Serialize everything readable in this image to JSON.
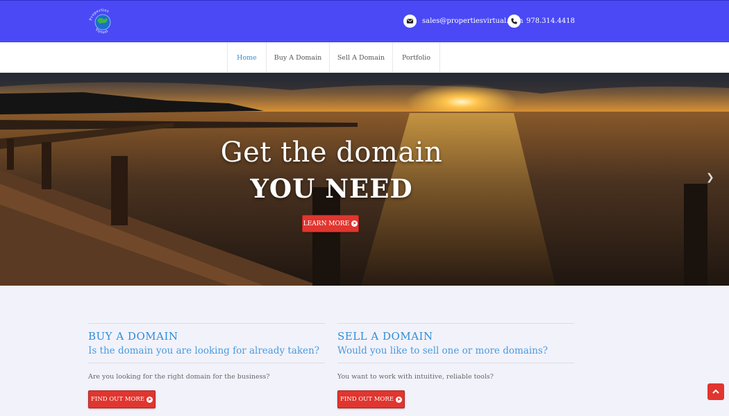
{
  "header": {
    "logo_name": "globe-logo",
    "logo_text": "Properties Virtual",
    "email": "sales@propertiesvirtual.com",
    "phone": "978.314.4418"
  },
  "nav": {
    "items": [
      {
        "label": "Home",
        "active": true
      },
      {
        "label": "Buy A Domain",
        "active": false
      },
      {
        "label": "Sell A Domain",
        "active": false
      },
      {
        "label": "Portfolio",
        "active": false
      }
    ]
  },
  "hero": {
    "title_line1": "Get the domain",
    "title_line2": "YOU NEED",
    "button_label": "LEARN MORE"
  },
  "features": [
    {
      "title": "BUY A DOMAIN",
      "subtitle": "Is the domain you are looking for already taken?",
      "text": "Are you looking for the right domain for the business?",
      "button_label": "FIND OUT MORE"
    },
    {
      "title": "SELL A DOMAIN",
      "subtitle": "Would you like to sell one or more domains?",
      "text": "You want to work with intuitive, reliable tools?",
      "button_label": "FIND OUT MORE"
    }
  ],
  "colors": {
    "header_bg": "#4a49f5",
    "accent_blue": "#2e8dd6",
    "button_red": "#e0362f",
    "page_bg": "#f2f2fb"
  },
  "icons": [
    "globe-logo",
    "envelope-icon",
    "phone-icon",
    "arrow-circle-right-icon",
    "chevron-right-icon",
    "chevron-up-icon"
  ]
}
